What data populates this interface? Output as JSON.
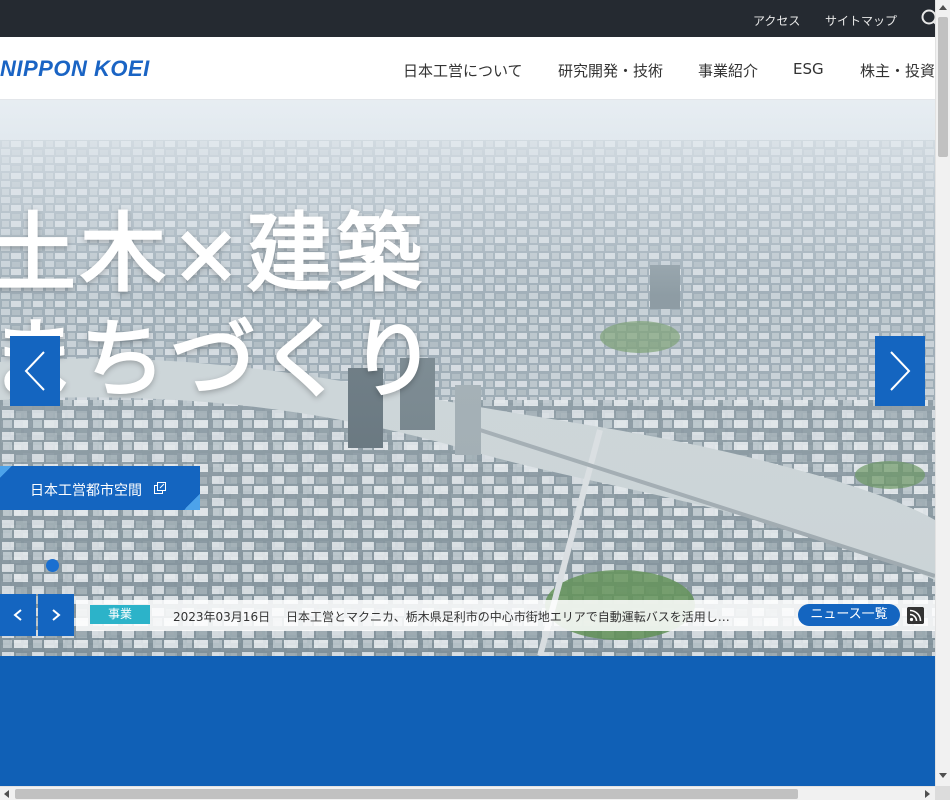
{
  "utility": {
    "access": "アクセス",
    "sitemap": "サイトマップ",
    "search_icon": "search-icon"
  },
  "header": {
    "logo_text": "NIPPON KOEI",
    "nav": [
      {
        "label": "日本工営について"
      },
      {
        "label": "研究開発・技術"
      },
      {
        "label": "事業紹介"
      },
      {
        "label": "ESG"
      },
      {
        "label": "株主・投資"
      }
    ]
  },
  "hero": {
    "headline_line1": "土木×建築",
    "headline_line2": "まちづくり",
    "cta_label": "日本工営都市空間",
    "prev_icon": "chevron-left-icon",
    "next_icon": "chevron-right-icon"
  },
  "news": {
    "category": "事業",
    "date": "2023年03月16日",
    "headline": "日本工営とマクニカ、栃木県足利市の中心市街地エリアで自動運転バスを活用し…",
    "list_label": "ニュース一覧",
    "rss_icon": "rss-icon"
  },
  "colors": {
    "brand_blue": "#1465c0",
    "utility_bar": "#252a31",
    "badge_teal": "#2cb3c9"
  }
}
